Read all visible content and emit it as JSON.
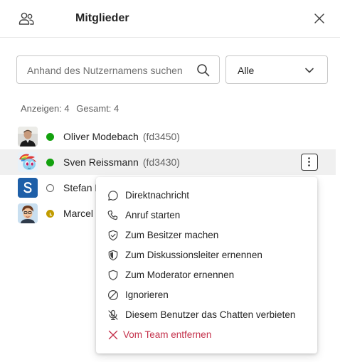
{
  "header": {
    "icon": "people-icon",
    "title": "Mitglieder",
    "close_icon": "close-icon"
  },
  "search": {
    "placeholder": "Anhand des Nutzernamens suchen",
    "value": "",
    "icon": "search-icon"
  },
  "filter": {
    "selected": "Alle",
    "icon": "chevron-down-icon"
  },
  "counts": {
    "shown": "Anzeigen: 4",
    "total": "Gesamt: 4"
  },
  "members": [
    {
      "name": "Oliver Modebach",
      "id": "(fd3450)",
      "status": "online",
      "status_color": "#13a10e"
    },
    {
      "name": "Sven Reissmann",
      "id": "(fd3430)",
      "status": "online",
      "status_color": "#13a10e"
    },
    {
      "name": "Stefan F",
      "id": "",
      "status": "offline",
      "status_color": "#8a8a8a"
    },
    {
      "name": "Marcel",
      "id": "",
      "status": "away",
      "status_color": "#c19c00"
    }
  ],
  "context_menu": {
    "items": [
      {
        "label": "Direktnachricht",
        "icon": "chat-icon"
      },
      {
        "label": "Anruf starten",
        "icon": "phone-icon"
      },
      {
        "label": "Zum Besitzer machen",
        "icon": "shield-check-icon"
      },
      {
        "label": "Zum Diskussionsleiter ernennen",
        "icon": "shield-half-icon"
      },
      {
        "label": "Zum Moderator ernennen",
        "icon": "shield-icon"
      },
      {
        "label": "Ignorieren",
        "icon": "block-icon"
      },
      {
        "label": "Diesem Benutzer das Chatten verbieten",
        "icon": "mic-off-icon"
      },
      {
        "label": "Vom Team entfernen",
        "icon": "remove-icon",
        "color": "#c4314b"
      }
    ]
  },
  "colors": {
    "accent_danger": "#c4314b",
    "online": "#13a10e",
    "away": "#c19c00",
    "stefan_avatar": "#1e5fa8"
  }
}
